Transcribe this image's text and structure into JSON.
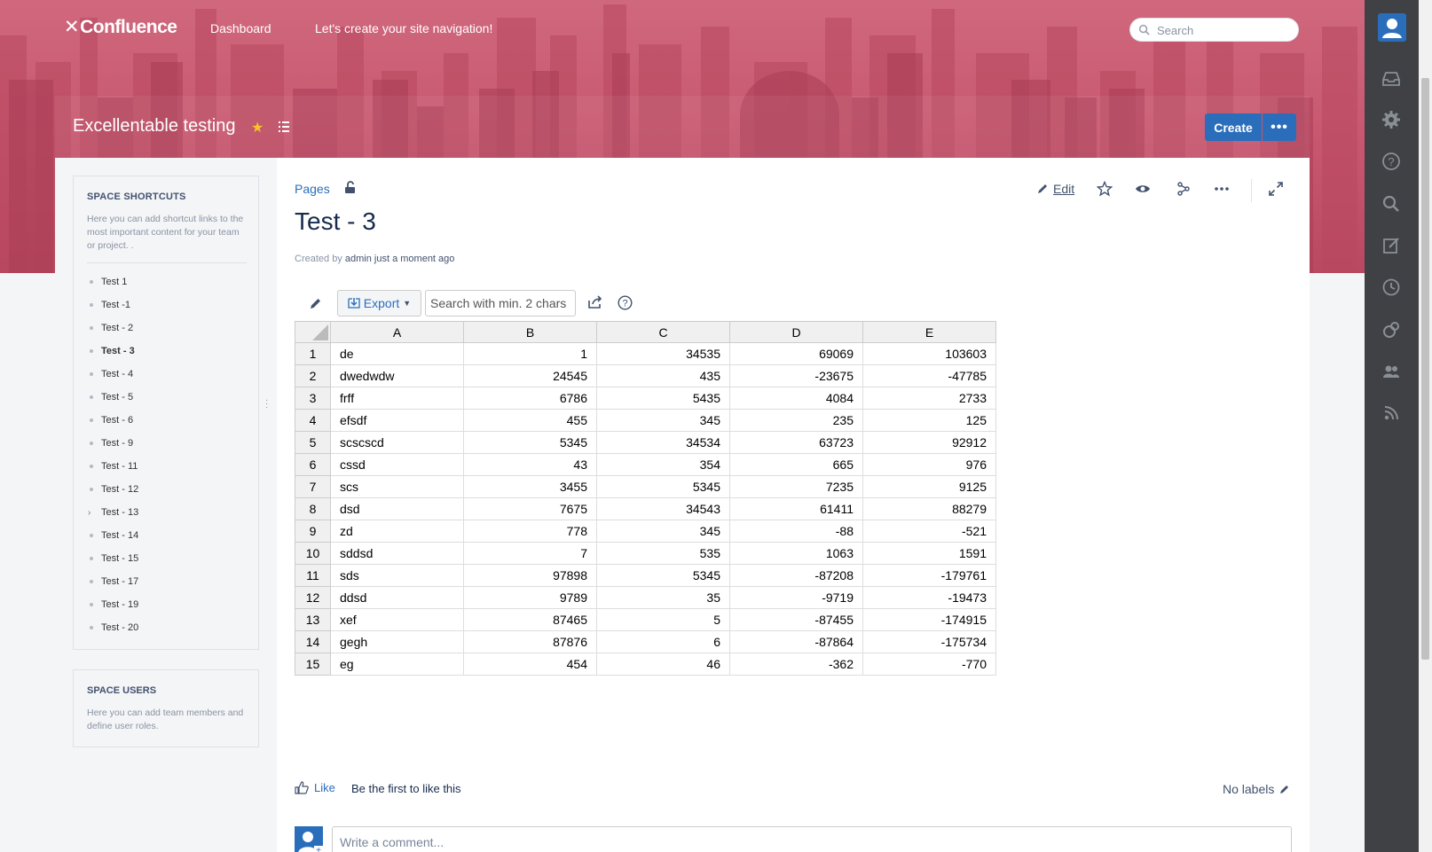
{
  "topnav": {
    "logo": "Confluence",
    "links": [
      "Dashboard",
      "Let's create your site navigation!"
    ],
    "search_placeholder": "Search"
  },
  "space": {
    "title": "Excellentable testing",
    "create_label": "Create",
    "more_label": "•••"
  },
  "sidebar": {
    "shortcuts_heading": "SPACE SHORTCUTS",
    "shortcuts_desc": "Here you can add shortcut links to the most important content for your team or project. .",
    "pages": [
      {
        "label": "Test 1"
      },
      {
        "label": "Test -1"
      },
      {
        "label": "Test - 2"
      },
      {
        "label": "Test - 3",
        "active": true
      },
      {
        "label": "Test - 4"
      },
      {
        "label": "Test - 5"
      },
      {
        "label": "Test - 6"
      },
      {
        "label": "Test - 9"
      },
      {
        "label": "Test - 11"
      },
      {
        "label": "Test - 12"
      },
      {
        "label": "Test - 13",
        "expandable": true
      },
      {
        "label": "Test - 14"
      },
      {
        "label": "Test - 15"
      },
      {
        "label": "Test - 17"
      },
      {
        "label": "Test - 19"
      },
      {
        "label": "Test - 20"
      }
    ],
    "users_heading": "SPACE USERS",
    "users_desc": "Here you can add team members and define user roles."
  },
  "page": {
    "breadcrumb": "Pages",
    "title": "Test - 3",
    "byline_prefix": "Created by",
    "author": "admin",
    "byline_suffix": "just a moment ago",
    "edit_label": "Edit"
  },
  "table_toolbar": {
    "export_label": "Export",
    "search_placeholder": "Search with min. 2 chars"
  },
  "sheet": {
    "columns": [
      "A",
      "B",
      "C",
      "D",
      "E"
    ],
    "rows": [
      [
        "de",
        "1",
        "34535",
        "69069",
        "103603"
      ],
      [
        "dwedwdw",
        "24545",
        "435",
        "-23675",
        "-47785"
      ],
      [
        "frff",
        "6786",
        "5435",
        "4084",
        "2733"
      ],
      [
        "efsdf",
        "455",
        "345",
        "235",
        "125"
      ],
      [
        "scscscd",
        "5345",
        "34534",
        "63723",
        "92912"
      ],
      [
        "cssd",
        "43",
        "354",
        "665",
        "976"
      ],
      [
        "scs",
        "3455",
        "5345",
        "7235",
        "9125"
      ],
      [
        "dsd",
        "7675",
        "34543",
        "61411",
        "88279"
      ],
      [
        "zd",
        "778",
        "345",
        "-88",
        "-521"
      ],
      [
        "sddsd",
        "7",
        "535",
        "1063",
        "1591"
      ],
      [
        "sds",
        "97898",
        "5345",
        "-87208",
        "-179761"
      ],
      [
        "ddsd",
        "9789",
        "35",
        "-9719",
        "-19473"
      ],
      [
        "xef",
        "87465",
        "5",
        "-87455",
        "-174915"
      ],
      [
        "gegh",
        "87876",
        "6",
        "-87864",
        "-175734"
      ],
      [
        "eg",
        "454",
        "46",
        "-362",
        "-770"
      ]
    ]
  },
  "footer": {
    "like_label": "Like",
    "like_msg": "Be the first to like this",
    "labels": "No labels",
    "comment_placeholder": "Write a comment..."
  },
  "colors": {
    "banner": "#c5546c",
    "primary": "#2a6ebb",
    "rail": "#3f4144"
  }
}
